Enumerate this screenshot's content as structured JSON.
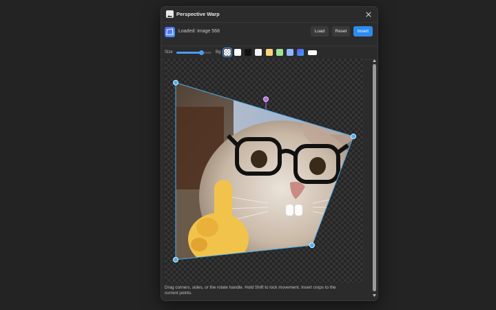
{
  "dialog": {
    "title": "Perspective Warp",
    "icons": {
      "app": "image-icon",
      "close": "close-icon"
    }
  },
  "toolbar": {
    "loaded_label": "Loaded: image 568",
    "load_label": "Load",
    "reset_label": "Reset",
    "insert_label": "Insert",
    "accent": "#2d8cf0"
  },
  "options": {
    "size_label": "Size",
    "size_value": 0.7,
    "bg_label": "Bg",
    "swatches": [
      {
        "name": "transparent",
        "color": "checker",
        "selected": true
      },
      {
        "name": "white",
        "color": "#ffffff"
      },
      {
        "name": "black",
        "color": "#111111"
      },
      {
        "name": "light",
        "color": "#f3f3f3"
      },
      {
        "name": "yellow",
        "color": "#fcd57a"
      },
      {
        "name": "green",
        "color": "#9ee39a"
      },
      {
        "name": "blue",
        "color": "#8fb8ff"
      },
      {
        "name": "custom",
        "color": "#5b5cf0"
      },
      {
        "name": "white-wide",
        "color": "#ffffff"
      }
    ]
  },
  "canvas": {
    "handle_color": "#4cb0f0",
    "rotate_handle_color": "#b36de0"
  },
  "hint_text": "Drag corners, sides, or the rotate handle. Hold Shift to lock movement. Insert crops to the current points."
}
